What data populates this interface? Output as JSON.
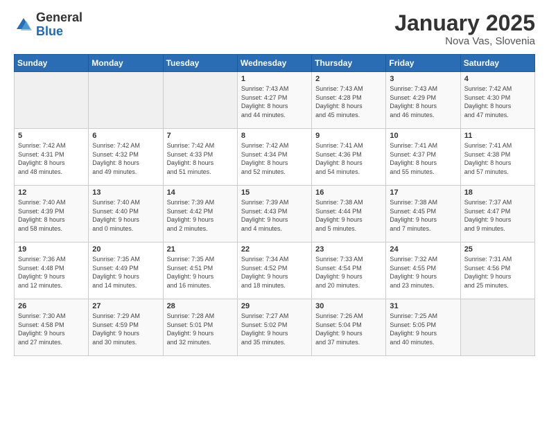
{
  "header": {
    "logo_general": "General",
    "logo_blue": "Blue",
    "month_title": "January 2025",
    "location": "Nova Vas, Slovenia"
  },
  "days_of_week": [
    "Sunday",
    "Monday",
    "Tuesday",
    "Wednesday",
    "Thursday",
    "Friday",
    "Saturday"
  ],
  "weeks": [
    [
      {
        "day": "",
        "info": ""
      },
      {
        "day": "",
        "info": ""
      },
      {
        "day": "",
        "info": ""
      },
      {
        "day": "1",
        "info": "Sunrise: 7:43 AM\nSunset: 4:27 PM\nDaylight: 8 hours\nand 44 minutes."
      },
      {
        "day": "2",
        "info": "Sunrise: 7:43 AM\nSunset: 4:28 PM\nDaylight: 8 hours\nand 45 minutes."
      },
      {
        "day": "3",
        "info": "Sunrise: 7:43 AM\nSunset: 4:29 PM\nDaylight: 8 hours\nand 46 minutes."
      },
      {
        "day": "4",
        "info": "Sunrise: 7:42 AM\nSunset: 4:30 PM\nDaylight: 8 hours\nand 47 minutes."
      }
    ],
    [
      {
        "day": "5",
        "info": "Sunrise: 7:42 AM\nSunset: 4:31 PM\nDaylight: 8 hours\nand 48 minutes."
      },
      {
        "day": "6",
        "info": "Sunrise: 7:42 AM\nSunset: 4:32 PM\nDaylight: 8 hours\nand 49 minutes."
      },
      {
        "day": "7",
        "info": "Sunrise: 7:42 AM\nSunset: 4:33 PM\nDaylight: 8 hours\nand 51 minutes."
      },
      {
        "day": "8",
        "info": "Sunrise: 7:42 AM\nSunset: 4:34 PM\nDaylight: 8 hours\nand 52 minutes."
      },
      {
        "day": "9",
        "info": "Sunrise: 7:41 AM\nSunset: 4:36 PM\nDaylight: 8 hours\nand 54 minutes."
      },
      {
        "day": "10",
        "info": "Sunrise: 7:41 AM\nSunset: 4:37 PM\nDaylight: 8 hours\nand 55 minutes."
      },
      {
        "day": "11",
        "info": "Sunrise: 7:41 AM\nSunset: 4:38 PM\nDaylight: 8 hours\nand 57 minutes."
      }
    ],
    [
      {
        "day": "12",
        "info": "Sunrise: 7:40 AM\nSunset: 4:39 PM\nDaylight: 8 hours\nand 58 minutes."
      },
      {
        "day": "13",
        "info": "Sunrise: 7:40 AM\nSunset: 4:40 PM\nDaylight: 9 hours\nand 0 minutes."
      },
      {
        "day": "14",
        "info": "Sunrise: 7:39 AM\nSunset: 4:42 PM\nDaylight: 9 hours\nand 2 minutes."
      },
      {
        "day": "15",
        "info": "Sunrise: 7:39 AM\nSunset: 4:43 PM\nDaylight: 9 hours\nand 4 minutes."
      },
      {
        "day": "16",
        "info": "Sunrise: 7:38 AM\nSunset: 4:44 PM\nDaylight: 9 hours\nand 5 minutes."
      },
      {
        "day": "17",
        "info": "Sunrise: 7:38 AM\nSunset: 4:45 PM\nDaylight: 9 hours\nand 7 minutes."
      },
      {
        "day": "18",
        "info": "Sunrise: 7:37 AM\nSunset: 4:47 PM\nDaylight: 9 hours\nand 9 minutes."
      }
    ],
    [
      {
        "day": "19",
        "info": "Sunrise: 7:36 AM\nSunset: 4:48 PM\nDaylight: 9 hours\nand 12 minutes."
      },
      {
        "day": "20",
        "info": "Sunrise: 7:35 AM\nSunset: 4:49 PM\nDaylight: 9 hours\nand 14 minutes."
      },
      {
        "day": "21",
        "info": "Sunrise: 7:35 AM\nSunset: 4:51 PM\nDaylight: 9 hours\nand 16 minutes."
      },
      {
        "day": "22",
        "info": "Sunrise: 7:34 AM\nSunset: 4:52 PM\nDaylight: 9 hours\nand 18 minutes."
      },
      {
        "day": "23",
        "info": "Sunrise: 7:33 AM\nSunset: 4:54 PM\nDaylight: 9 hours\nand 20 minutes."
      },
      {
        "day": "24",
        "info": "Sunrise: 7:32 AM\nSunset: 4:55 PM\nDaylight: 9 hours\nand 23 minutes."
      },
      {
        "day": "25",
        "info": "Sunrise: 7:31 AM\nSunset: 4:56 PM\nDaylight: 9 hours\nand 25 minutes."
      }
    ],
    [
      {
        "day": "26",
        "info": "Sunrise: 7:30 AM\nSunset: 4:58 PM\nDaylight: 9 hours\nand 27 minutes."
      },
      {
        "day": "27",
        "info": "Sunrise: 7:29 AM\nSunset: 4:59 PM\nDaylight: 9 hours\nand 30 minutes."
      },
      {
        "day": "28",
        "info": "Sunrise: 7:28 AM\nSunset: 5:01 PM\nDaylight: 9 hours\nand 32 minutes."
      },
      {
        "day": "29",
        "info": "Sunrise: 7:27 AM\nSunset: 5:02 PM\nDaylight: 9 hours\nand 35 minutes."
      },
      {
        "day": "30",
        "info": "Sunrise: 7:26 AM\nSunset: 5:04 PM\nDaylight: 9 hours\nand 37 minutes."
      },
      {
        "day": "31",
        "info": "Sunrise: 7:25 AM\nSunset: 5:05 PM\nDaylight: 9 hours\nand 40 minutes."
      },
      {
        "day": "",
        "info": ""
      }
    ]
  ]
}
